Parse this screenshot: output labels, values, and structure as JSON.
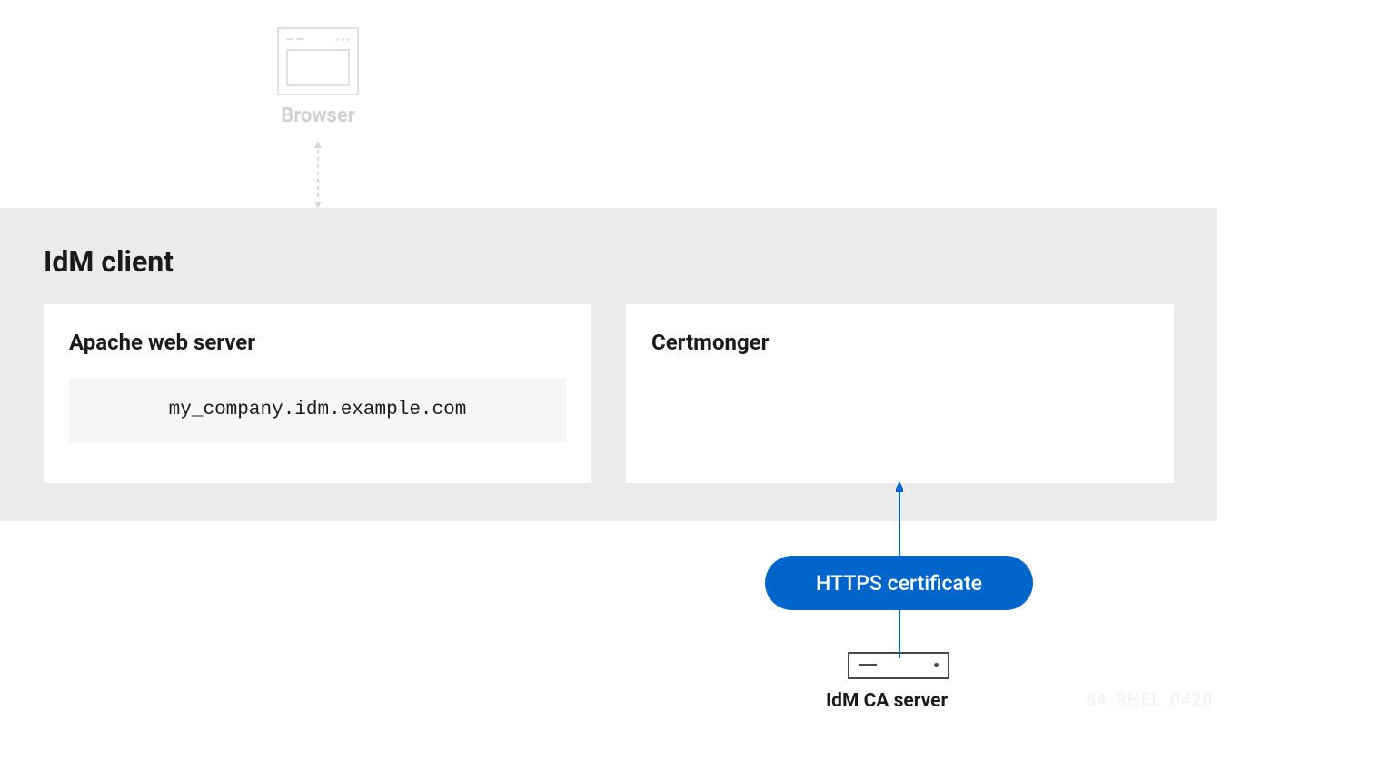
{
  "browser": {
    "label": "Browser"
  },
  "idm_client": {
    "title": "IdM client",
    "panels": {
      "apache": {
        "title": "Apache web server",
        "hostname": "my_company.idm.example.com"
      },
      "certmonger": {
        "title": "Certmonger"
      }
    }
  },
  "certificate_badge": "HTTPS certificate",
  "server": {
    "label": "IdM CA server"
  },
  "watermark": "84_RHEL_0420",
  "colors": {
    "accent_blue": "#0066cc",
    "grey_bg": "#ebebeb",
    "light_grey": "#e0e0e0",
    "text_dark": "#1a1a1a"
  }
}
